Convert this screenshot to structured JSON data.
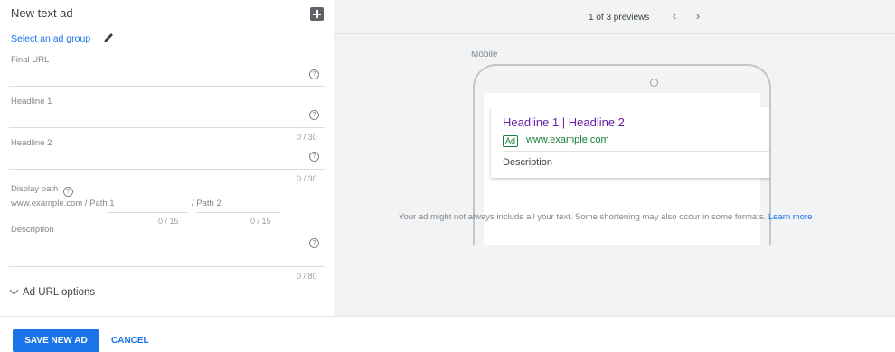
{
  "left_panel": {
    "title": "New text ad",
    "ad_group_link": "Select an ad group",
    "final_url": {
      "label": "Final URL",
      "value": ""
    },
    "headline1": {
      "label": "Headline 1",
      "value": ""
    },
    "headline2": {
      "label": "Headline 2",
      "value": "",
      "counter": "0 / 30"
    },
    "headline_after_counter": "0 / 30",
    "display_path": {
      "label": "Display path",
      "base": "www.example.com / Path 1",
      "path2": "/ Path 2",
      "path1_counter": "0 / 15",
      "path2_counter": "0 / 15"
    },
    "description": {
      "label": "Description",
      "value": "",
      "counter": "0 / 80"
    },
    "ad_url_options": "Ad URL options",
    "help_glyph": "?"
  },
  "preview": {
    "count_text": "1 of 3 previews",
    "prev_glyph": "‹",
    "next_glyph": "›",
    "device_label": "Mobile",
    "ad": {
      "headline": "Headline 1 | Headline 2",
      "badge": "Ad",
      "url": "www.example.com",
      "description": "Description",
      "info_glyph": "i"
    },
    "disclaimer": "Your ad might not always include all your text. Some shortening may also occur in some formats.",
    "learn_more": "Learn more"
  },
  "footer": {
    "save_label": "SAVE NEW AD",
    "cancel_label": "CANCEL"
  },
  "colors": {
    "accent": "#1a73e8",
    "headline_purple": "#681da8",
    "url_green": "#188038",
    "preview_bg": "#f1f3f4"
  },
  "icons": [
    "collapse-icon",
    "pencil-icon",
    "help-icon",
    "chevron-down-icon",
    "info-icon",
    "chevron-left-icon",
    "chevron-right-icon"
  ]
}
